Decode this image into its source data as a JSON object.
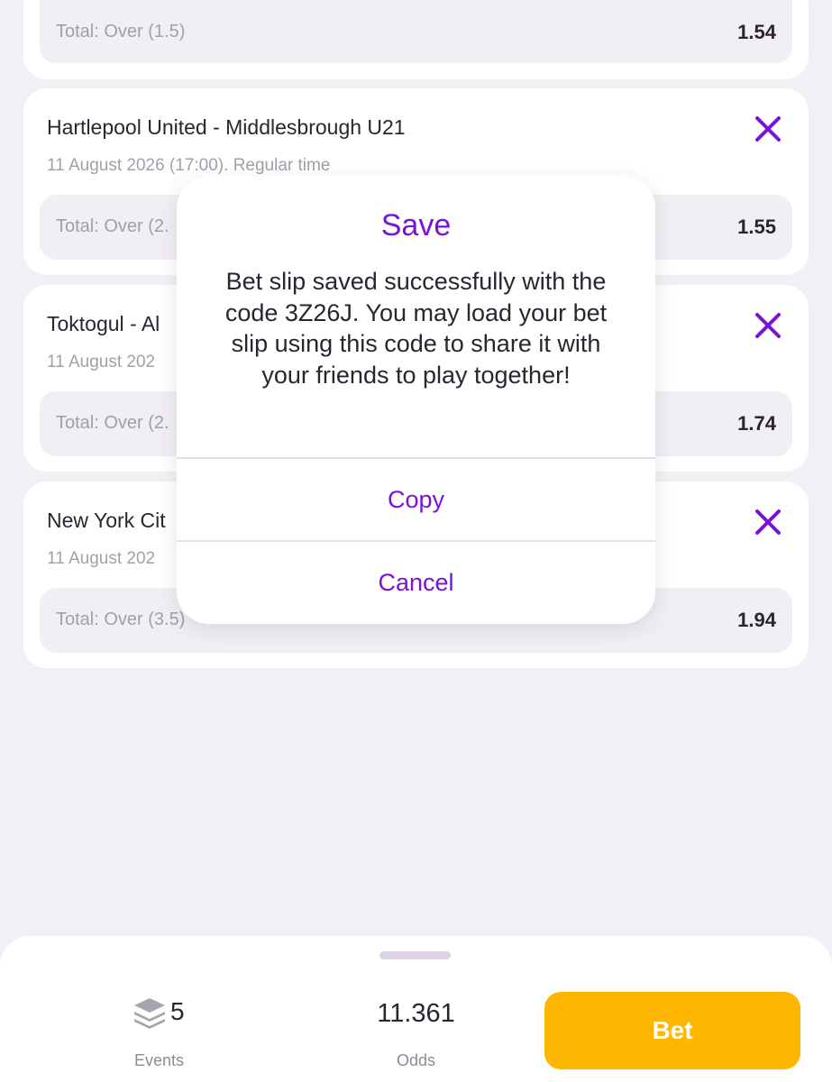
{
  "colors": {
    "accent": "#7a12d8",
    "bet_button": "#ffb600",
    "background": "#f3f0f5"
  },
  "cards": [
    {
      "title": "",
      "subtitle": "",
      "market": "Total: Over (1.5)",
      "odds": "1.54"
    },
    {
      "title": "Hartlepool United - Middlesbrough U21",
      "subtitle": "11 August 2026 (17:00). Regular time",
      "market": "Total: Over (2.",
      "odds": "1.55"
    },
    {
      "title": "Toktogul - Al",
      "subtitle": "11 August 202",
      "market": "Total: Over (2.",
      "odds": "1.74"
    },
    {
      "title": "New York Cit",
      "subtitle": "11 August 202",
      "market": "Total: Over (3.5)",
      "odds": "1.94"
    }
  ],
  "modal": {
    "title": "Save",
    "message": "Bet slip saved successfully with the code 3Z26J. You may load your bet slip using this code to share it with your friends to play together!",
    "copy_label": "Copy",
    "cancel_label": "Cancel"
  },
  "footer": {
    "events_count": "5",
    "events_label": "Events",
    "odds_value": "11.361",
    "odds_label": "Odds",
    "bet_label": "Bet",
    "events_icon": "stack-icon"
  }
}
